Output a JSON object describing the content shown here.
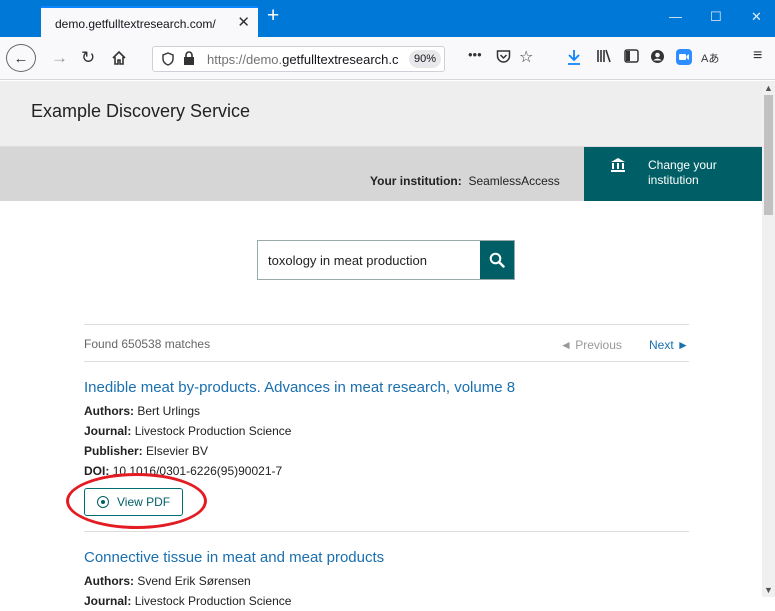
{
  "browser": {
    "tab_title": "demo.getfulltextresearch.com/",
    "tab_close": "✕",
    "new_tab": "+",
    "url_prefix": "https://demo.",
    "url_domain": "getfulltextresearch.c",
    "zoom": "90%",
    "more": "•••",
    "translate": "Aあ"
  },
  "site": {
    "title": "Example Discovery Service",
    "institution_label": "Your institution:",
    "institution_value": "SeamlessAccess",
    "change_institution_line1": "Change your",
    "change_institution_line2": "institution"
  },
  "search": {
    "query": "toxology in meat production"
  },
  "results_header": {
    "found": "Found 650538 matches",
    "previous": "◄ Previous",
    "next": "Next ►"
  },
  "results": [
    {
      "title": "Inedible meat by-products. Advances in meat research, volume 8",
      "authors_label": "Authors:",
      "authors": "Bert Urlings",
      "journal_label": "Journal:",
      "journal": "Livestock Production Science",
      "publisher_label": "Publisher:",
      "publisher": "Elsevier BV",
      "doi_label": "DOI:",
      "doi": "10.1016/0301-6226(95)90021-7",
      "view_pdf": "View PDF"
    },
    {
      "title": "Connective tissue in meat and meat products",
      "authors_label": "Authors:",
      "authors": "Svend Erik Sørensen",
      "journal_label": "Journal:",
      "journal": "Livestock Production Science"
    }
  ],
  "colors": {
    "accent": "#005f66",
    "link": "#1a6faf",
    "highlight": "#e31b23",
    "titlebar": "#0078d7"
  }
}
